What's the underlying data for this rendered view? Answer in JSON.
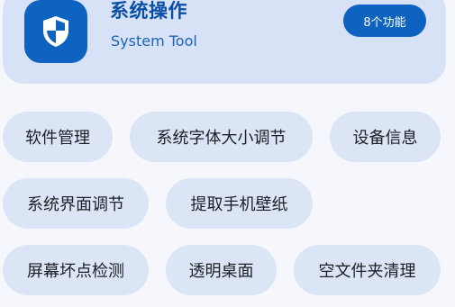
{
  "header": {
    "title": "系统操作",
    "subtitle": "System Tool",
    "badge": "8个功能",
    "icon": "shield-icon",
    "colors": {
      "accent": "#0e63c0",
      "card_bg": "#d7e2f6",
      "chip_bg": "#dbe5f5",
      "page_bg": "#f5f7fd"
    }
  },
  "features": [
    {
      "label": "软件管理"
    },
    {
      "label": "系统字体大小调节"
    },
    {
      "label": "设备信息"
    },
    {
      "label": "系统界面调节"
    },
    {
      "label": "提取手机壁纸"
    },
    {
      "label": "屏幕坏点检测"
    },
    {
      "label": "透明桌面"
    },
    {
      "label": "空文件夹清理"
    }
  ]
}
